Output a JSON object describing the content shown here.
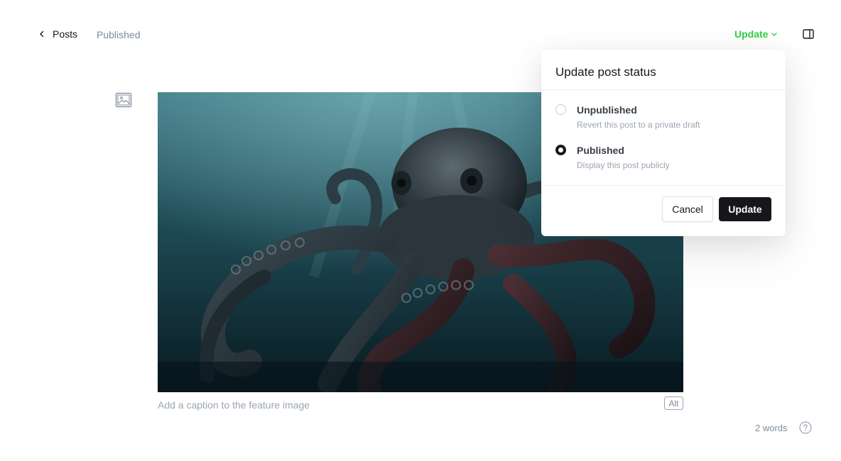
{
  "header": {
    "back_label": "Posts",
    "status": "Published",
    "update_label": "Update"
  },
  "editor": {
    "caption_placeholder": "Add a caption to the feature image",
    "alt_label": "Alt",
    "word_count": "2 words"
  },
  "popover": {
    "title": "Update post status",
    "options": [
      {
        "title": "Unpublished",
        "description": "Revert this post to a private draft",
        "selected": false
      },
      {
        "title": "Published",
        "description": "Display this post publicly",
        "selected": true
      }
    ],
    "cancel_label": "Cancel",
    "update_label": "Update"
  },
  "icons": {
    "back": "chevron-left-icon",
    "dropdown": "chevron-down-icon",
    "sidebar": "sidebar-panel-icon",
    "feature_image": "image-icon",
    "help": "question-mark-icon"
  },
  "colors": {
    "accent_green": "#30cf43",
    "text_dark": "#15171a",
    "text_muted": "#7c8b9a",
    "button_dark": "#15171a"
  }
}
